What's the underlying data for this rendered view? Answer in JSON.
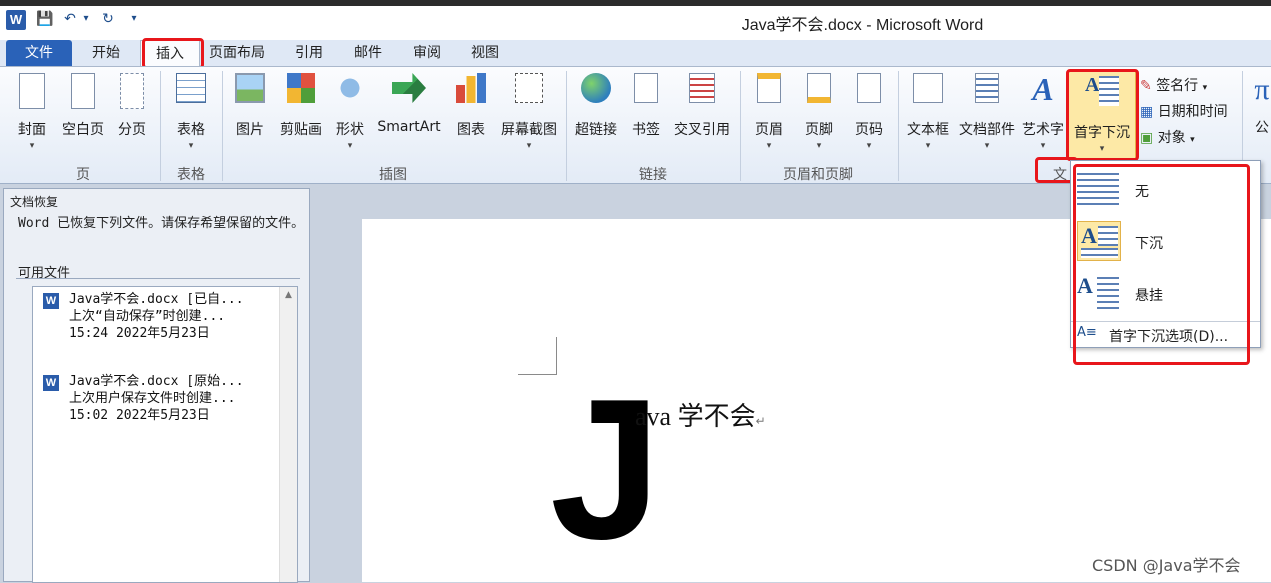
{
  "window": {
    "title": "Java学不会.docx - Microsoft Word",
    "app_icon": "W"
  },
  "qat": {
    "save": "💾",
    "undo": "↶",
    "undo_more": "▾",
    "redo": "↻",
    "customize": "▾"
  },
  "tabs": [
    "文件",
    "开始",
    "插入",
    "页面布局",
    "引用",
    "邮件",
    "审阅",
    "视图"
  ],
  "ribbon": {
    "page": {
      "label": "页",
      "buttons": [
        "封面",
        "空白页",
        "分页"
      ]
    },
    "table": {
      "label": "表格",
      "buttons": [
        "表格"
      ]
    },
    "illustrations": {
      "label": "插图",
      "buttons": [
        "图片",
        "剪贴画",
        "形状",
        "SmartArt",
        "图表",
        "屏幕截图"
      ]
    },
    "links": {
      "label": "链接",
      "buttons": [
        "超链接",
        "书签",
        "交叉引用"
      ]
    },
    "header_footer": {
      "label": "页眉和页脚",
      "buttons": [
        "页眉",
        "页脚",
        "页码"
      ]
    },
    "text": {
      "label": "文",
      "buttons": [
        "文本框",
        "文档部件",
        "艺术字",
        "首字下沉"
      ],
      "small": [
        "签名行",
        "日期和时间",
        "对象"
      ]
    },
    "partial": "公"
  },
  "recovery_pane": {
    "title": "文档恢复",
    "description": "Word 已恢复下列文件。请保存希望保留的文件。",
    "available": "可用文件",
    "files": [
      {
        "line1": "Java学不会.docx  [已自...",
        "line2": "上次“自动保存”时创建...",
        "line3": "15:24 2022年5月23日"
      },
      {
        "line1": "Java学不会.docx  [原始...",
        "line2": "上次用户保存文件时创建...",
        "line3": "15:02 2022年5月23日"
      }
    ]
  },
  "document": {
    "dropcap": "J",
    "text": "ava 学不会",
    "para_mark": "↵"
  },
  "dropcap_menu": {
    "items": [
      "无",
      "下沉",
      "悬挂"
    ],
    "options": "首字下沉选项(D)..."
  },
  "watermark": "CSDN @Java学不会",
  "colors": {
    "highlight": "#e8161b",
    "file_tab": "#2a62b8",
    "selected": "#fde9a6"
  }
}
